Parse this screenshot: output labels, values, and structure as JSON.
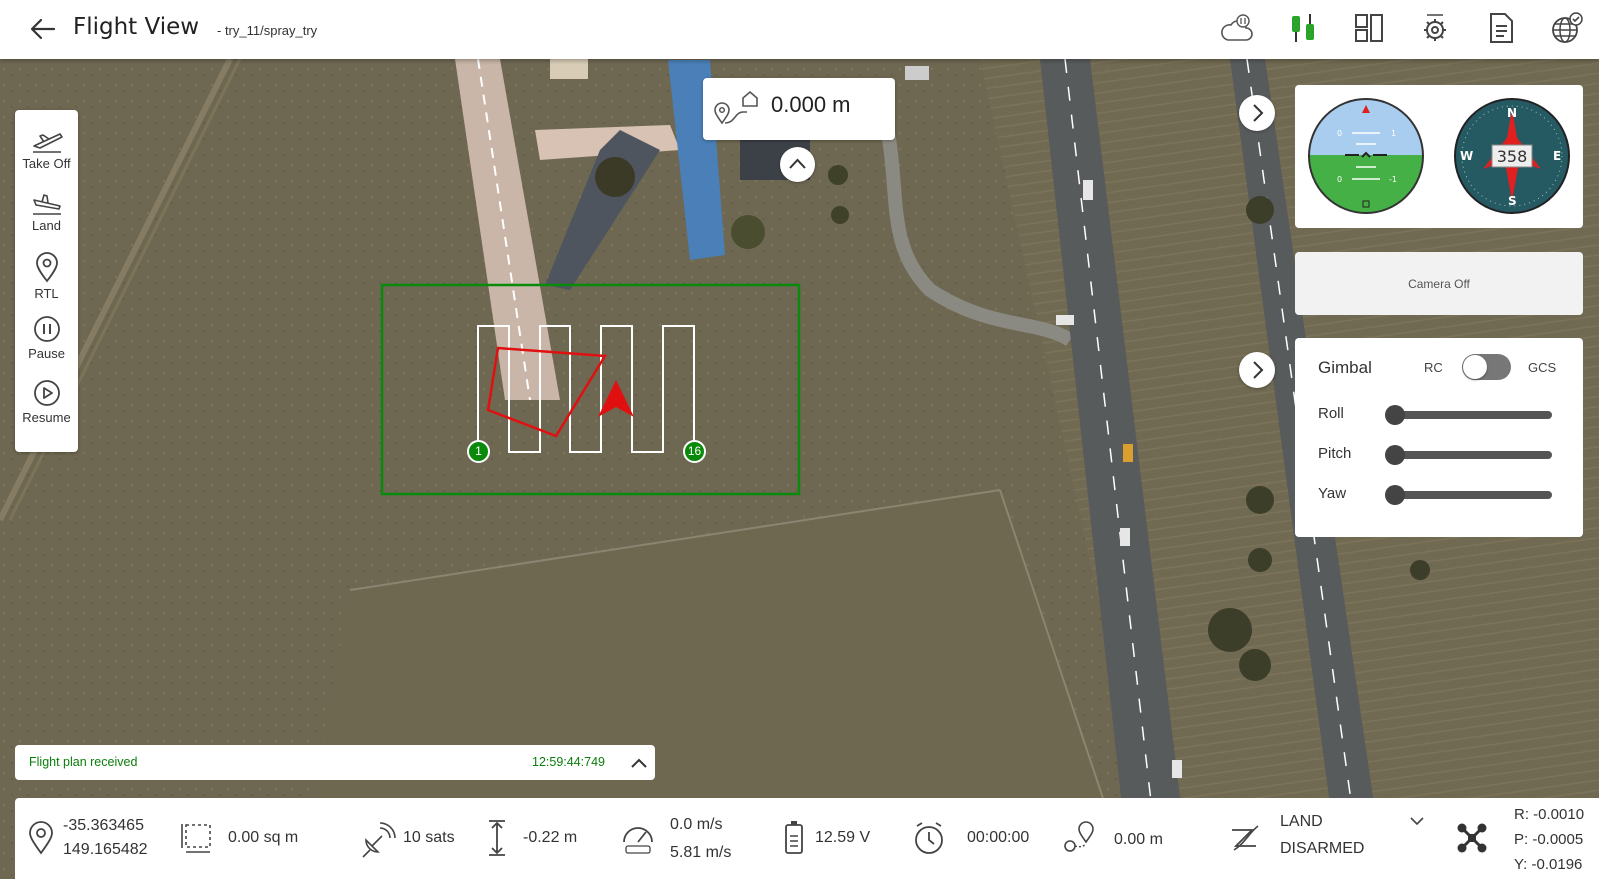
{
  "header": {
    "title": "Flight View",
    "subtitle": "- try_11/spray_try"
  },
  "actions": [
    {
      "label": "Take Off",
      "icon": "takeoff-icon"
    },
    {
      "label": "Land",
      "icon": "land-icon"
    },
    {
      "label": "RTL",
      "icon": "location-pin-icon"
    },
    {
      "label": "Pause",
      "icon": "pause-icon"
    },
    {
      "label": "Resume",
      "icon": "play-icon"
    }
  ],
  "distance": {
    "value": "0.000 m"
  },
  "mission": {
    "start_waypoint": "1",
    "end_waypoint": "16",
    "boundary_color": "#0a8a0a",
    "path_color": "#ffffff",
    "drone_color": "#e01010"
  },
  "instruments": {
    "heading": "358",
    "compass": {
      "n": "N",
      "e": "E",
      "s": "S",
      "w": "W"
    },
    "attitude_ticks": {
      "upper_left": "0",
      "upper_right": "1",
      "lower_left": "0",
      "lower_right": "-1"
    }
  },
  "camera": {
    "status": "Camera Off"
  },
  "gimbal": {
    "title": "Gimbal",
    "rc_label": "RC",
    "gcs_label": "GCS",
    "rows": [
      {
        "label": "Roll",
        "value": 0
      },
      {
        "label": "Pitch",
        "value": 0
      },
      {
        "label": "Yaw",
        "value": 0
      }
    ]
  },
  "message": {
    "text": "Flight plan received",
    "time": "12:59:44:749"
  },
  "status": {
    "lat": "-35.363465",
    "lon": "149.165482",
    "area": "0.00 sq m",
    "sats": "10 sats",
    "altitude": "-0.22 m",
    "speed_vertical": "0.0 m/s",
    "speed_ground": "5.81 m/s",
    "battery": "12.59 V",
    "timer": "00:00:00",
    "home_distance": "0.00 m",
    "mode": "LAND",
    "arm_state": "DISARMED",
    "roll": "R: -0.0010",
    "pitch": "P: -0.0005",
    "yaw": "Y: -0.0196"
  }
}
